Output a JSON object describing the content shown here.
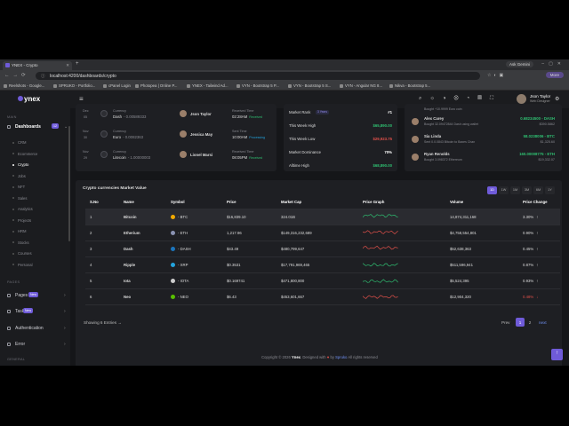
{
  "browser": {
    "tab_title": "YNEX - Crypto",
    "url": "localhost:4200/dashboards/crypto",
    "ask_gemini": "Ask Gemini",
    "more_label": "More",
    "bookmarks": [
      "Reelshots - Google...",
      "SPRUKO - Portfolio...",
      "cPanel Login",
      "Photopea | Online P...",
      "YNEX - Tailwind Ad...",
      "VYN - Bootstrap 5 P...",
      "VYN - Bootstrap 5 S...",
      "VYN - Angular NG 8...",
      "Nikva - Bootstrap 5..."
    ]
  },
  "sidebar": {
    "logo": "ynex",
    "main_label": "MAIN",
    "dashboards": {
      "label": "Dashboards",
      "badge": "12"
    },
    "subitems": [
      "CRM",
      "Ecommerce",
      "Crypto",
      "Jobs",
      "NFT",
      "Sales",
      "Analytics",
      "Projects",
      "HRM",
      "Stocks",
      "Courses",
      "Personal"
    ],
    "active_sub": "Crypto",
    "pages_label": "PAGES",
    "pages": {
      "label": "Pages",
      "badge": "New"
    },
    "task": {
      "label": "Task",
      "badge": "New"
    },
    "authentication": "Authentication",
    "error": "Error",
    "general_label": "GENERAL"
  },
  "topbar": {
    "user_name": "Json Taylor",
    "user_role": "Web Designer",
    "notif_count": "5",
    "cart_count": "4"
  },
  "transactions": [
    {
      "month": "Dec",
      "day": "05",
      "currency_label": "Currency",
      "currency": "Dash",
      "amount": "- 0.00589333",
      "person": "Json Taylor",
      "status_label": "Received Time",
      "time": "02:28AM",
      "status": "Received"
    },
    {
      "month": "Nov",
      "day": "30",
      "currency_label": "Currency",
      "currency": "Euro",
      "amount": "- 0.0082363",
      "person": "Jessica May",
      "status_label": "Sent Time",
      "time": "10:00AM",
      "status": "Processing"
    },
    {
      "month": "Nov",
      "day": "29",
      "currency_label": "Currency",
      "currency": "Litecoin",
      "amount": "- 1.00000003",
      "person": "Lionel Marsi",
      "status_label": "Received Time",
      "time": "08:05PM",
      "status": "Received"
    }
  ],
  "market_stats": [
    {
      "label": "Market Rank",
      "badge": "3 Years",
      "value": "#1"
    },
    {
      "label": "This Week High",
      "value": "$65,890.00"
    },
    {
      "label": "This Week Low",
      "value": "$29,923.75"
    },
    {
      "label": "Market Dominance",
      "value": "70%"
    },
    {
      "label": "Alltime High",
      "value": "$68,890.00"
    }
  ],
  "recent_activity": [
    {
      "name": "",
      "desc": "Bought +10.9999 Euro coin",
      "amount": "",
      "sub": ""
    },
    {
      "name": "Alex Carey",
      "desc": "Bought 32.09472844 Dash using wallet",
      "amount": "0.68234500 - DASH",
      "sub": "$390.5862"
    },
    {
      "name": "Sia Linda",
      "desc": "Sent 0.0.0843 Bitcoin to Baxes Chan",
      "amount": "58.0238006 - BTC",
      "sub": "$1,325.60"
    },
    {
      "name": "Ryan Renolds",
      "desc": "Bought 3.098372 Ethereum",
      "amount": "160.00008775 - ETH",
      "sub": "$19,332.07"
    }
  ],
  "market_table": {
    "title": "Crypto currencies Market Value",
    "timeframes": [
      "1D",
      "1W",
      "1M",
      "3M",
      "6M",
      "1Y"
    ],
    "active_tf": "1D",
    "columns": [
      "S.No",
      "Name",
      "Symbol",
      "Price",
      "Market Cap",
      "Price Graph",
      "Volume",
      "Price Change"
    ],
    "rows": [
      {
        "sno": "1",
        "name": "Bitcoin",
        "symbol": "- BTC",
        "price": "$16,839.10",
        "cap": "324.01B",
        "volume": "14,874,311,168",
        "change": "3.30%",
        "dir": "up",
        "color": "#f2a900",
        "line": "#2fbf71"
      },
      {
        "sno": "2",
        "name": "Etherium",
        "symbol": "- ETH",
        "price": "1,217.96",
        "cap": "$149,316,232,689",
        "volume": "$4,758,554,801",
        "change": "0.90%",
        "dir": "up",
        "color": "#8a92b2",
        "line": "#e0504a"
      },
      {
        "sno": "3",
        "name": "Dash",
        "symbol": "- DASH",
        "price": "$43.49",
        "cap": "$480,799,647",
        "volume": "$52,638,363",
        "change": "0.45%",
        "dir": "up",
        "color": "#1c75bc",
        "line": "#e0504a"
      },
      {
        "sno": "4",
        "name": "Ripple",
        "symbol": "- XRP",
        "price": "$0.3531",
        "cap": "$17,791,969,465",
        "volume": "$511,596,941",
        "change": "0.87%",
        "dir": "up",
        "color": "#23a3dd",
        "line": "#2fbf71"
      },
      {
        "sno": "5",
        "name": "Iota",
        "symbol": "- IOTA",
        "price": "$0.169741",
        "cap": "$471,800,800",
        "volume": "$5,524,395",
        "change": "0.93%",
        "dir": "up",
        "color": "#cccccc",
        "line": "#2fbf71"
      },
      {
        "sno": "6",
        "name": "Neo",
        "symbol": "- NEO",
        "price": "$6.43",
        "cap": "$453,601,667",
        "volume": "$12,904,320",
        "change": "0.48%",
        "dir": "down",
        "color": "#58bf00",
        "line": "#e0504a"
      }
    ],
    "showing": "Showing 6 Entries",
    "showing_arrow": "→",
    "prev": "Prev",
    "pages": [
      "1",
      "2"
    ],
    "next": "next"
  },
  "footer": {
    "prefix": "Copyright © 2026",
    "brand": "Ynex",
    "mid": ". Designed with",
    "heart": "♥",
    "by": "by",
    "author": "Spruko",
    "suffix": "All rights reserved"
  },
  "colors": {
    "accent": "#6f5bd9",
    "up": "#2fbf71",
    "down": "#e0504a"
  }
}
